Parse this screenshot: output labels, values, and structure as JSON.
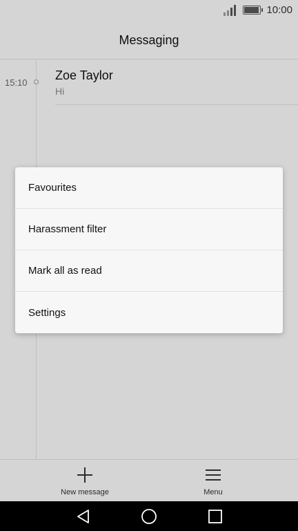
{
  "status_bar": {
    "time": "10:00",
    "signal_icon": "signal-icon",
    "battery_icon": "battery-icon",
    "battery_level": 1.0
  },
  "header": {
    "title": "Messaging"
  },
  "conversations": [
    {
      "time": "15:10",
      "name": "Zoe Taylor",
      "snippet": "Hi"
    }
  ],
  "toolbar": {
    "new_message": {
      "label": "New message",
      "icon": "plus-icon"
    },
    "menu": {
      "label": "Menu",
      "icon": "menu-icon"
    }
  },
  "popup_menu": {
    "items": [
      {
        "label": "Favourites"
      },
      {
        "label": "Harassment filter"
      },
      {
        "label": "Mark all as read"
      },
      {
        "label": "Settings"
      }
    ]
  },
  "nav_bar": {
    "back_icon": "back-icon",
    "home_icon": "home-icon",
    "recents_icon": "recents-icon"
  },
  "colors": {
    "background": "#f5f5f5",
    "text": "#111111",
    "muted": "#888888",
    "nav": "#000000"
  }
}
